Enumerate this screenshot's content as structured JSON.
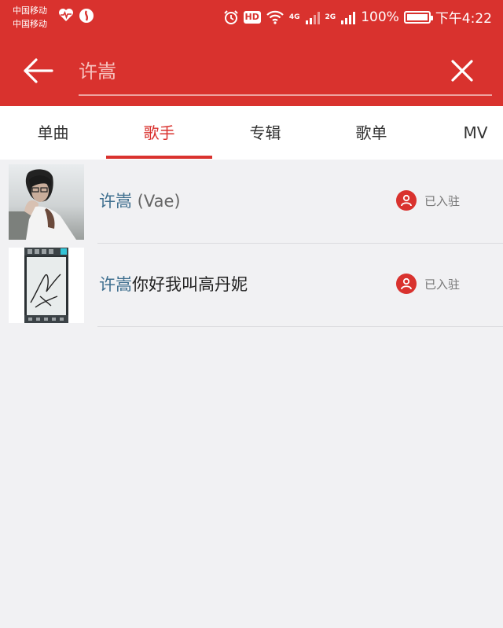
{
  "status_bar": {
    "carrier1": "中国移动",
    "carrier2": "中国移动",
    "network1": "4G",
    "network2": "2G",
    "battery": "100%",
    "time": "下午4:22",
    "icons": [
      "heartbeat-icon",
      "app-notification-icon",
      "alarm-icon",
      "hd-icon",
      "wifi-icon",
      "signal-icon",
      "battery-icon"
    ],
    "hd_label": "HD"
  },
  "search": {
    "value": "许嵩",
    "back_icon": "back-arrow-icon",
    "clear_icon": "close-icon"
  },
  "tabs": [
    {
      "label": "单曲"
    },
    {
      "label": "歌手"
    },
    {
      "label": "专辑"
    },
    {
      "label": "歌单"
    },
    {
      "label": "MV"
    }
  ],
  "active_tab": 1,
  "results": [
    {
      "name_highlight": "许嵩",
      "name_rest": " (Vae)",
      "status": "已入驻",
      "status_icon": "user-icon",
      "thumb": "artist-photo"
    },
    {
      "name_highlight": "许嵩",
      "name_rest": "你好我叫高丹妮",
      "status": "已入驻",
      "status_icon": "user-icon",
      "thumb": "signature-screenshot"
    }
  ],
  "colors": {
    "accent": "#d9322e",
    "highlight": "#3f6f8f",
    "background": "#f1f1f3"
  }
}
